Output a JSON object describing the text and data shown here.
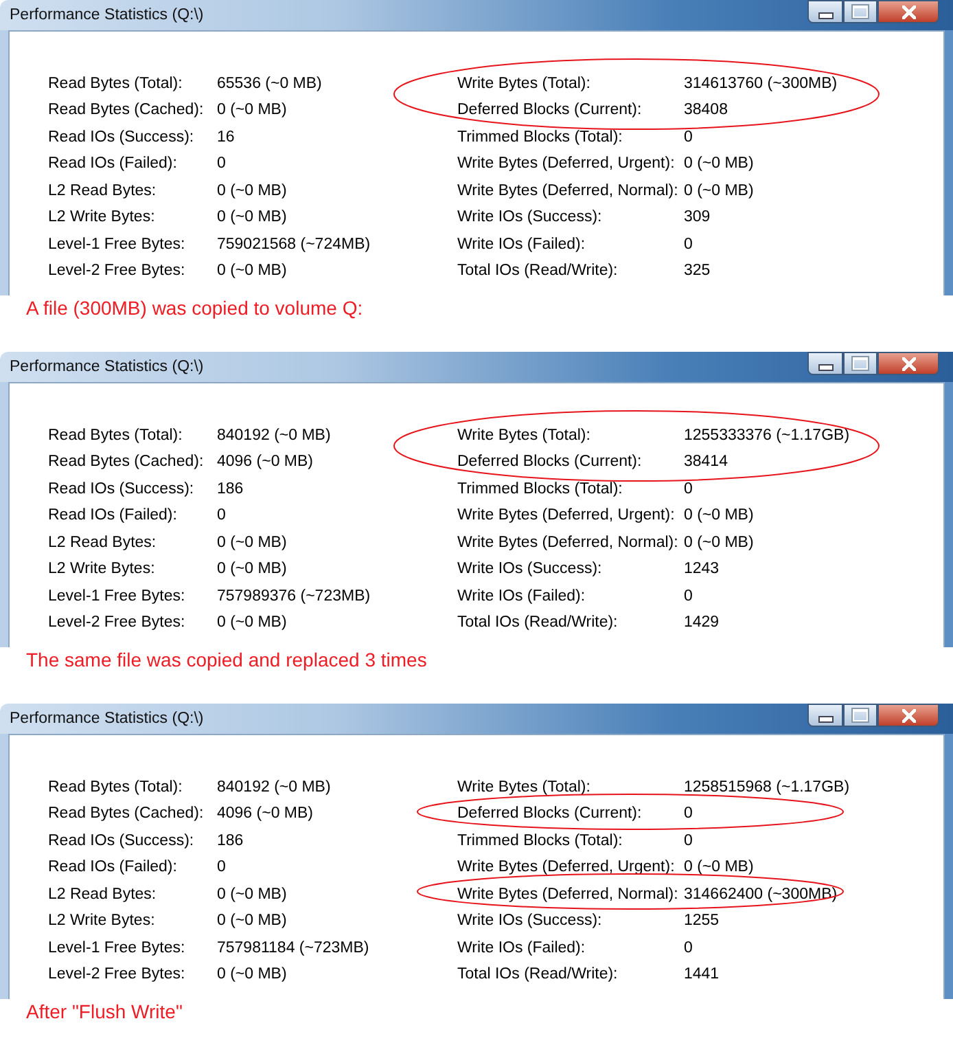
{
  "panels": [
    {
      "window": {
        "title": "Performance Statistics (Q:\\)"
      },
      "left_rows": [
        {
          "label": "Read Bytes (Total):",
          "value": "65536 (~0 MB)"
        },
        {
          "label": "Read Bytes (Cached):",
          "value": "0 (~0 MB)"
        },
        {
          "label": "Read IOs (Success):",
          "value": "16"
        },
        {
          "label": "Read IOs (Failed):",
          "value": "0"
        },
        {
          "label": "L2 Read Bytes:",
          "value": "0 (~0 MB)"
        },
        {
          "label": "L2 Write Bytes:",
          "value": "0 (~0 MB)"
        },
        {
          "label": "Level-1 Free Bytes:",
          "value": "759021568 (~724MB)"
        },
        {
          "label": "Level-2 Free Bytes:",
          "value": "0 (~0 MB)"
        }
      ],
      "right_rows": [
        {
          "label": "Write Bytes (Total):",
          "value": "314613760 (~300MB)",
          "circled": true
        },
        {
          "label": "Deferred Blocks (Current):",
          "value": "38408",
          "circled": true
        },
        {
          "label": "Trimmed Blocks (Total):",
          "value": "0",
          "circled": false
        },
        {
          "label": "Write Bytes (Deferred, Urgent):",
          "value": "0 (~0 MB)",
          "circled": false
        },
        {
          "label": "Write Bytes (Deferred, Normal):",
          "value": "0 (~0 MB)",
          "circled": false
        },
        {
          "label": "Write IOs (Success):",
          "value": "309",
          "circled": false
        },
        {
          "label": "Write IOs (Failed):",
          "value": "0",
          "circled": false
        },
        {
          "label": "Total IOs (Read/Write):",
          "value": "325",
          "circled": false
        }
      ],
      "caption": "A file (300MB) was copied to volume Q:"
    },
    {
      "window": {
        "title": "Performance Statistics (Q:\\)"
      },
      "left_rows": [
        {
          "label": "Read Bytes (Total):",
          "value": "840192 (~0 MB)"
        },
        {
          "label": "Read Bytes (Cached):",
          "value": "4096 (~0 MB)"
        },
        {
          "label": "Read IOs (Success):",
          "value": "186"
        },
        {
          "label": "Read IOs (Failed):",
          "value": "0"
        },
        {
          "label": "L2 Read Bytes:",
          "value": "0 (~0 MB)"
        },
        {
          "label": "L2 Write Bytes:",
          "value": "0 (~0 MB)"
        },
        {
          "label": "Level-1 Free Bytes:",
          "value": "757989376 (~723MB)"
        },
        {
          "label": "Level-2 Free Bytes:",
          "value": "0 (~0 MB)"
        }
      ],
      "right_rows": [
        {
          "label": "Write Bytes (Total):",
          "value": "1255333376 (~1.17GB)",
          "circled": true
        },
        {
          "label": "Deferred Blocks (Current):",
          "value": "38414",
          "circled": true
        },
        {
          "label": "Trimmed Blocks (Total):",
          "value": "0",
          "circled": false
        },
        {
          "label": "Write Bytes (Deferred, Urgent):",
          "value": "0 (~0 MB)",
          "circled": false
        },
        {
          "label": "Write Bytes (Deferred, Normal):",
          "value": "0 (~0 MB)",
          "circled": false
        },
        {
          "label": "Write IOs (Success):",
          "value": "1243",
          "circled": false
        },
        {
          "label": "Write IOs (Failed):",
          "value": "0",
          "circled": false
        },
        {
          "label": "Total IOs (Read/Write):",
          "value": "1429",
          "circled": false
        }
      ],
      "caption": "The same file was copied and replaced 3 times"
    },
    {
      "window": {
        "title": "Performance Statistics (Q:\\)"
      },
      "left_rows": [
        {
          "label": "Read Bytes (Total):",
          "value": "840192 (~0 MB)"
        },
        {
          "label": "Read Bytes (Cached):",
          "value": "4096 (~0 MB)"
        },
        {
          "label": "Read IOs (Success):",
          "value": "186"
        },
        {
          "label": "Read IOs (Failed):",
          "value": "0"
        },
        {
          "label": "L2 Read Bytes:",
          "value": "0 (~0 MB)"
        },
        {
          "label": "L2 Write Bytes:",
          "value": "0 (~0 MB)"
        },
        {
          "label": "Level-1 Free Bytes:",
          "value": "757981184 (~723MB)"
        },
        {
          "label": "Level-2 Free Bytes:",
          "value": "0 (~0 MB)"
        }
      ],
      "right_rows": [
        {
          "label": "Write Bytes (Total):",
          "value": "1258515968 (~1.17GB)",
          "circled": false
        },
        {
          "label": "Deferred Blocks (Current):",
          "value": "0",
          "circled": true
        },
        {
          "label": "Trimmed Blocks (Total):",
          "value": "0",
          "circled": false
        },
        {
          "label": "Write Bytes (Deferred, Urgent):",
          "value": "0 (~0 MB)",
          "circled": false
        },
        {
          "label": "Write Bytes (Deferred, Normal):",
          "value": "314662400 (~300MB)",
          "circled": true
        },
        {
          "label": "Write IOs (Success):",
          "value": "1255",
          "circled": false
        },
        {
          "label": "Write IOs (Failed):",
          "value": "0",
          "circled": false
        },
        {
          "label": "Total IOs (Read/Write):",
          "value": "1441",
          "circled": false
        }
      ],
      "caption": "After \"Flush Write\""
    }
  ]
}
